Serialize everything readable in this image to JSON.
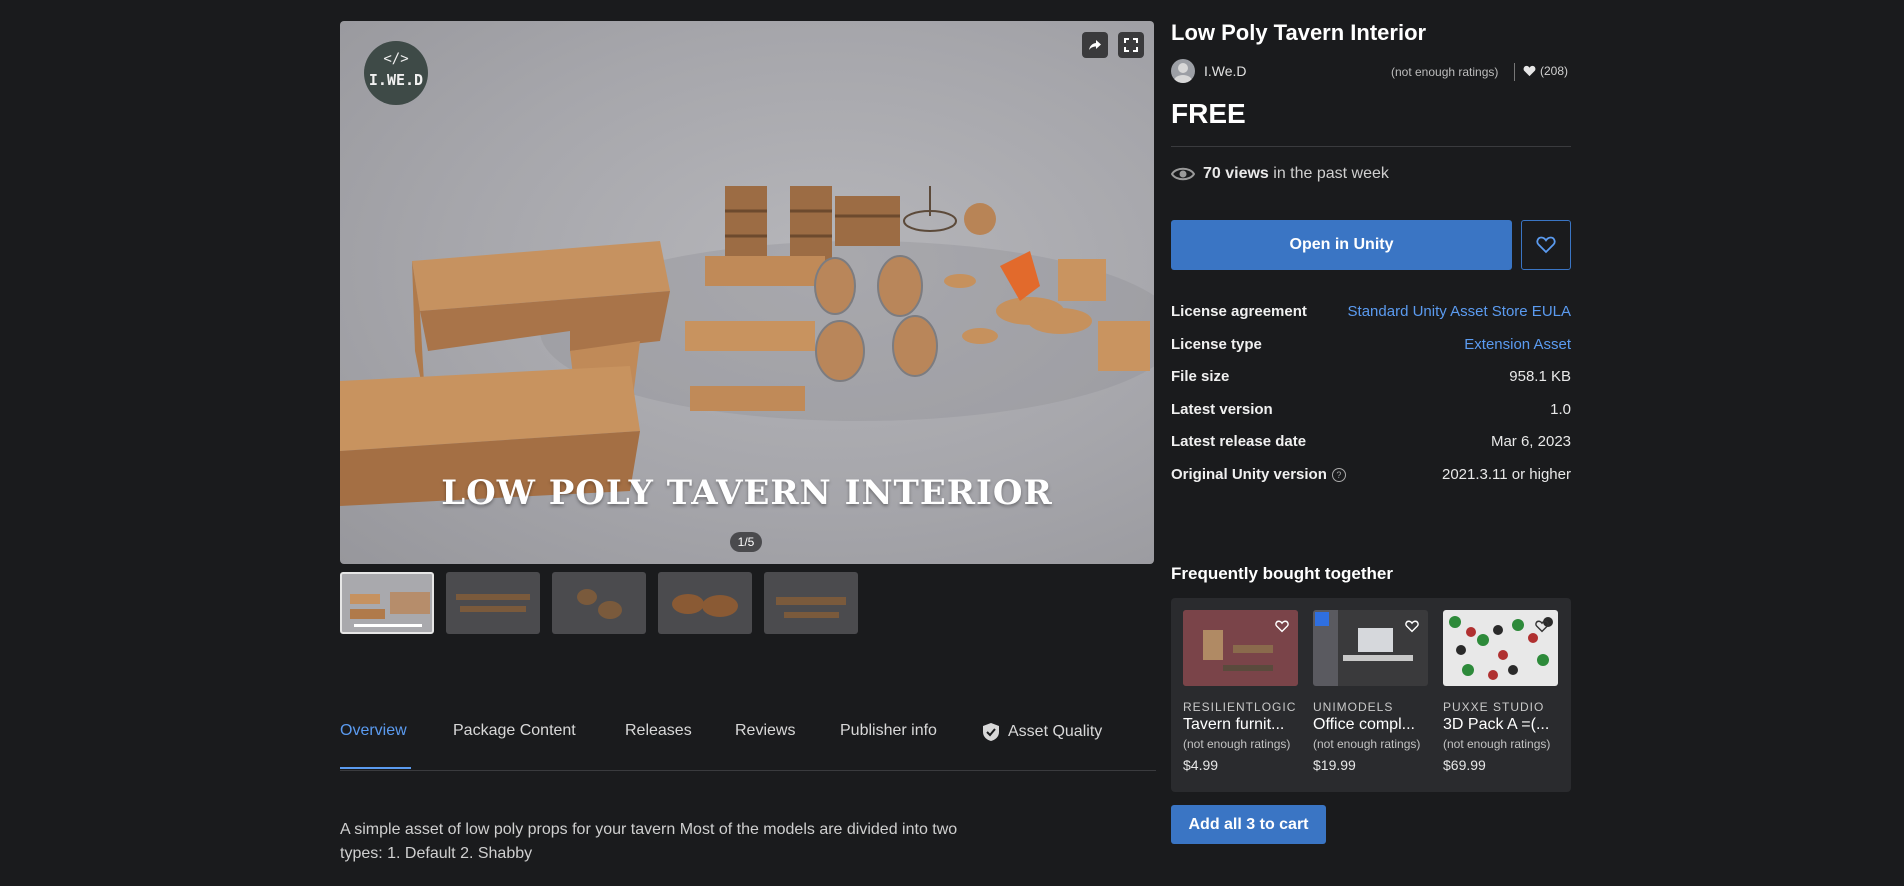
{
  "product": {
    "title": "Low Poly Tavern Interior",
    "publisher": "I.We.D",
    "ratings_text": "(not enough ratings)",
    "likes": "(208)",
    "price": "FREE",
    "views_count": "70 views",
    "views_suffix": "in the past week",
    "open_button": "Open in Unity"
  },
  "gallery": {
    "logo_code": "</>",
    "logo_text": "I.WE.D",
    "hero_title": "LOW POLY TAVERN INTERIOR",
    "counter": "1/5",
    "thumbnail_count": 5
  },
  "details": [
    {
      "label": "License agreement",
      "value": "Standard Unity Asset Store EULA",
      "link": true
    },
    {
      "label": "License type",
      "value": "Extension Asset",
      "link": true
    },
    {
      "label": "File size",
      "value": "958.1 KB",
      "link": false
    },
    {
      "label": "Latest version",
      "value": "1.0",
      "link": false
    },
    {
      "label": "Latest release date",
      "value": "Mar 6, 2023",
      "link": false
    },
    {
      "label": "Original Unity version",
      "value": "2021.3.11 or higher",
      "link": false
    }
  ],
  "tabs": [
    "Overview",
    "Package Content",
    "Releases",
    "Reviews",
    "Publisher info",
    "Asset Quality"
  ],
  "description": "A simple asset of low poly props for your tavern Most of the models are divided into two types: 1. Default 2. Shabby",
  "fbt": {
    "title": "Frequently bought together",
    "items": [
      {
        "publisher": "RESILIENTLOGIC",
        "name": "Tavern furnit...",
        "rating": "(not enough ratings)",
        "price": "$4.99"
      },
      {
        "publisher": "UNIMODELS",
        "name": "Office compl...",
        "rating": "(not enough ratings)",
        "price": "$19.99"
      },
      {
        "publisher": "PUXXE STUDIO",
        "name": "3D Pack A =(...",
        "rating": "(not enough ratings)",
        "price": "$69.99"
      }
    ],
    "add_all": "Add all 3 to cart"
  },
  "colors": {
    "accent": "#3a75c4",
    "link": "#5b9bf0",
    "background": "#1a1b1d"
  }
}
